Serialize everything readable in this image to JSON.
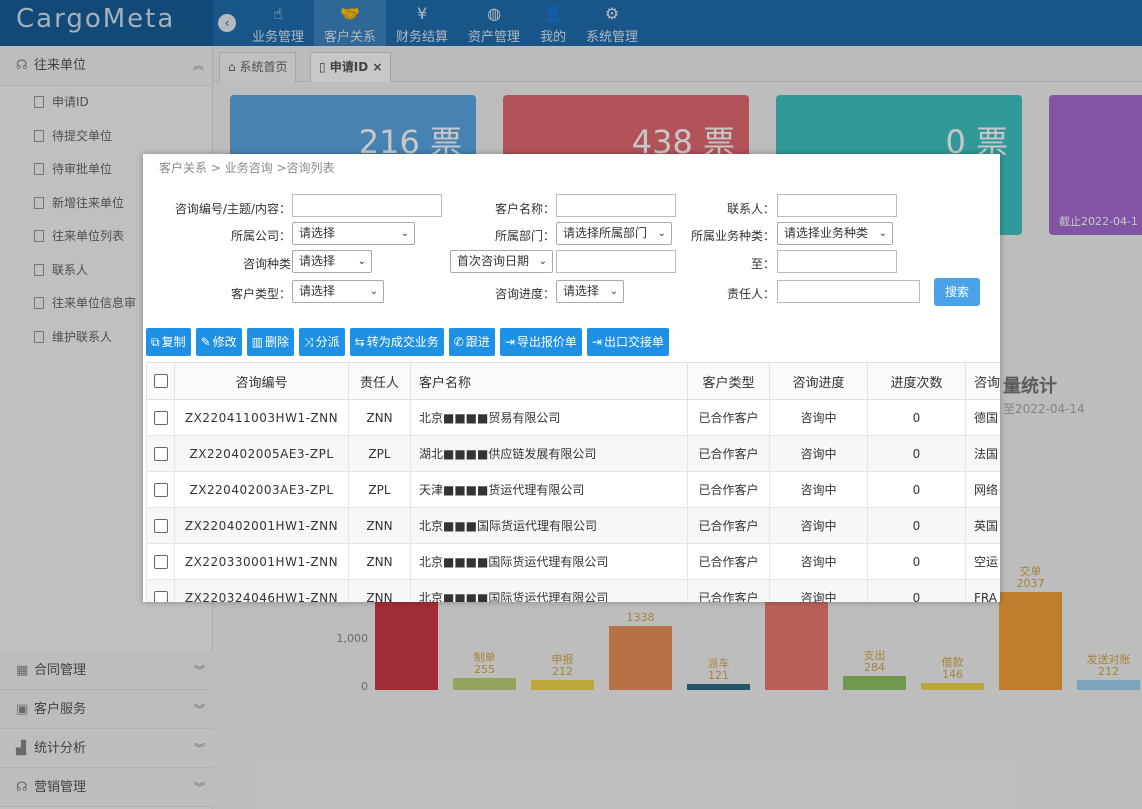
{
  "app": {
    "logo": "CargoMeta",
    "collapse_icon": "chevron-left-icon"
  },
  "topnav": [
    {
      "label": "业务管理",
      "icon": "hand-pointer-icon"
    },
    {
      "label": "客户关系",
      "icon": "handshake-icon",
      "active": true
    },
    {
      "label": "财务结算",
      "icon": "yen-icon"
    },
    {
      "label": "资产管理",
      "icon": "basketball-icon"
    },
    {
      "label": "我的",
      "icon": "user-icon"
    },
    {
      "label": "系统管理",
      "icon": "gear-icon"
    }
  ],
  "sidebar": {
    "group_open": "往来单位",
    "items": [
      "申请ID",
      "待提交单位",
      "待审批单位",
      "新增往来单位",
      "往来单位列表",
      "联系人",
      "往来单位信息审",
      "维护联系人"
    ],
    "groups_bottom": [
      "合同管理",
      "客户服务",
      "统计分析",
      "营销管理"
    ]
  },
  "tabs": [
    {
      "label": "系统首页",
      "icon": "home-icon"
    },
    {
      "label": "申请ID",
      "icon": "document-icon",
      "close": "×"
    }
  ],
  "dashboard": {
    "cards": [
      {
        "value": "216 票",
        "color": "#5aa8e6"
      },
      {
        "value": "438 票",
        "color": "#e46a72"
      },
      {
        "value": "0 票",
        "color": "#41c5c4"
      },
      {
        "value": "",
        "color": "#a66cd3",
        "note": "截止2022-04-1"
      }
    ],
    "chart_title": "量统计",
    "chart_sub": "至2022-04-14",
    "y_ticks": [
      "1,000",
      "0"
    ],
    "bars": [
      {
        "label": "",
        "value": "",
        "color": "#cf3a48"
      },
      {
        "label": "制单",
        "value": "255",
        "color": "#bdd278"
      },
      {
        "label": "申报",
        "value": "212",
        "color": "#f3d64e"
      },
      {
        "label": "",
        "value": "1338",
        "color": "#e9935a"
      },
      {
        "label": "派车",
        "value": "121",
        "color": "#2f6e86"
      },
      {
        "label": "",
        "value": "",
        "color": "#ee7b74"
      },
      {
        "label": "支出",
        "value": "284",
        "color": "#8fc564"
      },
      {
        "label": "借款",
        "value": "146",
        "color": "#f3d64e"
      },
      {
        "label": "交单",
        "value": "2037",
        "color": "#f3a23b"
      },
      {
        "label": "发送对账",
        "value": "212",
        "color": "#9fd3ef"
      }
    ]
  },
  "modal": {
    "breadcrumb": "客户关系 > 业务咨询 >咨询列表",
    "form": {
      "consult_no_label": "咨询编号/主题/内容：",
      "customer_name_label": "客户名称：",
      "contact_label": "联系人：",
      "company_label": "所属公司：",
      "company_value": "请选择",
      "dept_label": "所属部门：",
      "dept_value": "请选择所属部门",
      "biz_type_label": "所属业务种类：",
      "biz_type_value": "请选择业务种类",
      "consult_type_label": "咨询种类",
      "consult_type_value": "请选择",
      "date_type_value": "首次咨询日期",
      "to_label": "至：",
      "customer_type_label": "客户类型：",
      "customer_type_value": "请选择",
      "progress_label": "咨询进度：",
      "progress_value": "请选择",
      "owner_label": "责任人：",
      "search_label": "搜索"
    },
    "toolbar": [
      {
        "label": "复制",
        "icon": "copy-icon",
        "glyph": "⧉"
      },
      {
        "label": "修改",
        "icon": "pencil-icon",
        "glyph": "✎"
      },
      {
        "label": "删除",
        "icon": "trash-icon",
        "glyph": "🗑"
      },
      {
        "label": "分派",
        "icon": "shuffle-icon",
        "glyph": "⤨"
      },
      {
        "label": "转为成交业务",
        "icon": "exchange-icon",
        "glyph": "⇆"
      },
      {
        "label": "跟进",
        "icon": "whatsapp-icon",
        "glyph": "✆"
      },
      {
        "label": "导出报价单",
        "icon": "export-icon",
        "glyph": "⇥"
      },
      {
        "label": "出口交接单",
        "icon": "export-icon",
        "glyph": "⇥"
      }
    ],
    "table": {
      "headers": [
        "咨询编号",
        "责任人",
        "客户名称",
        "客户类型",
        "咨询进度",
        "进度次数",
        "咨询"
      ],
      "rows": [
        [
          "ZX220411003HW1-ZNN",
          "ZNN",
          "北京■■■■贸易有限公司",
          "已合作客户",
          "咨询中",
          "0",
          "德国"
        ],
        [
          "ZX220402005AE3-ZPL",
          "ZPL",
          "湖北■■■■供应链发展有限公司",
          "已合作客户",
          "咨询中",
          "0",
          "法国"
        ],
        [
          "ZX220402003AE3-ZPL",
          "ZPL",
          "天津■■■■货运代理有限公司",
          "已合作客户",
          "咨询中",
          "0",
          "网络"
        ],
        [
          "ZX220402001HW1-ZNN",
          "ZNN",
          "北京■■■国际货运代理有限公司",
          "已合作客户",
          "咨询中",
          "0",
          "英国"
        ],
        [
          "ZX220330001HW1-ZNN",
          "ZNN",
          "北京■■■■国际货运代理有限公司",
          "已合作客户",
          "咨询中",
          "0",
          "空运"
        ],
        [
          "ZX220324046HW1-ZNN",
          "ZNN",
          "北京■■■■国际货运代理有限公司",
          "已合作客户",
          "咨询中",
          "0",
          "FRA"
        ]
      ]
    }
  }
}
